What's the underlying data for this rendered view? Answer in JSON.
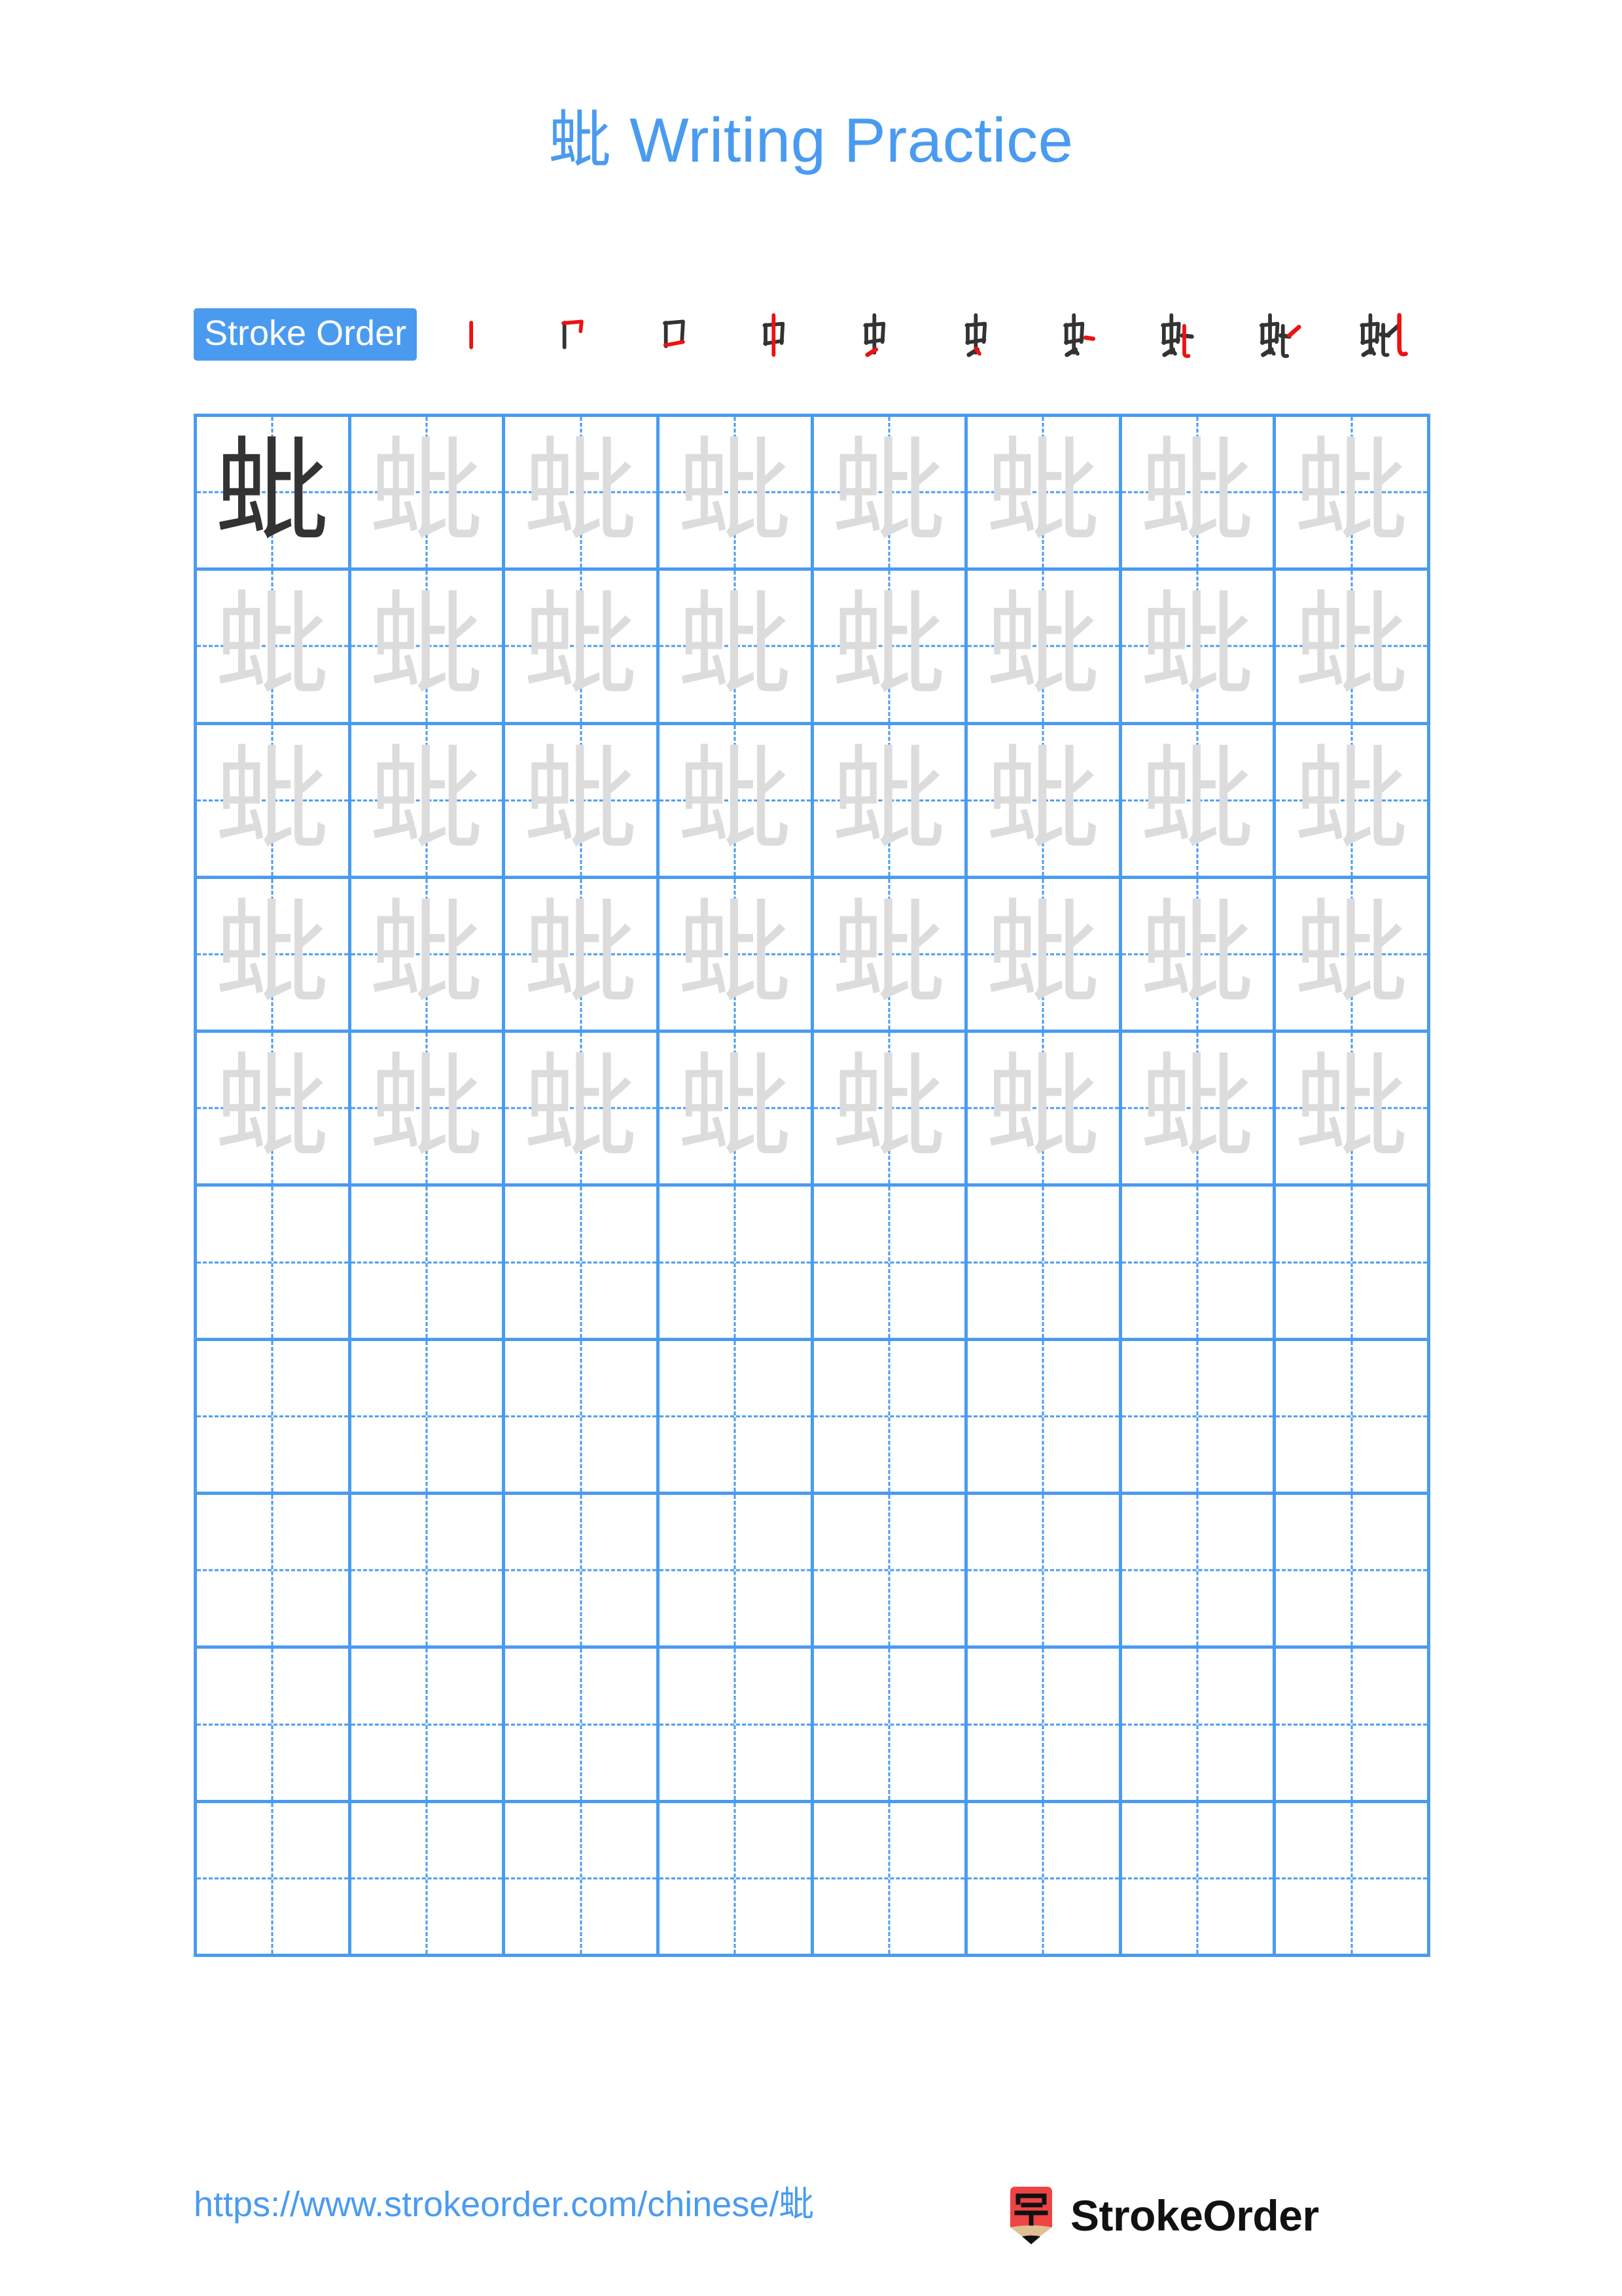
{
  "character": "蚍",
  "title": "蚍 Writing Practice",
  "colors": {
    "accent_blue": "#4A9BF0",
    "grid_line": "#4A9BF0",
    "trace_gray": "#DCDCDC",
    "model_char": "#333333",
    "stroke_new": "#EE1111",
    "stroke_old": "#333333",
    "logo_red": "#EF4444",
    "logo_wood": "#E0C092"
  },
  "stroke_order": {
    "badge_label": "Stroke Order",
    "stroke_count": 10,
    "steps": [
      {
        "index": 1,
        "glyph": "丨"
      },
      {
        "index": 2,
        "glyph": "冂"
      },
      {
        "index": 3,
        "glyph": "口"
      },
      {
        "index": 4,
        "glyph": "中"
      },
      {
        "index": 5,
        "glyph": "虫"
      },
      {
        "index": 6,
        "glyph": "虫"
      },
      {
        "index": 7,
        "glyph": "虫丶"
      },
      {
        "index": 8,
        "glyph": "虫ヒ"
      },
      {
        "index": 9,
        "glyph": "虫ヒ"
      },
      {
        "index": 10,
        "glyph": "蚍"
      }
    ]
  },
  "grid": {
    "rows": 10,
    "columns": 8,
    "filled_rows": 5,
    "empty_rows": 5,
    "model_cell": {
      "row": 1,
      "column": 1,
      "char": "蚍"
    },
    "trace_char": "蚍"
  },
  "footer": {
    "url": "https://www.strokeorder.com/chinese/蚍",
    "brand_name": "StrokeOrder",
    "logo_char": "字"
  }
}
